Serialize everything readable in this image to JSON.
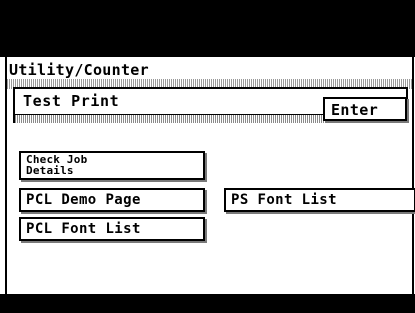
{
  "screen": {
    "title": "Utility/Counter"
  },
  "panel": {
    "label": "Test Print",
    "enter_label": "Enter"
  },
  "buttons": {
    "check_job_details": "Check Job\nDetails",
    "pcl_demo_page": "PCL Demo Page",
    "ps_font_list": "PS Font List",
    "pcl_font_list": "PCL Font List"
  },
  "colors": {
    "background": "#ffffff",
    "bars": "#000000",
    "hatch": "#9a9a9a"
  }
}
